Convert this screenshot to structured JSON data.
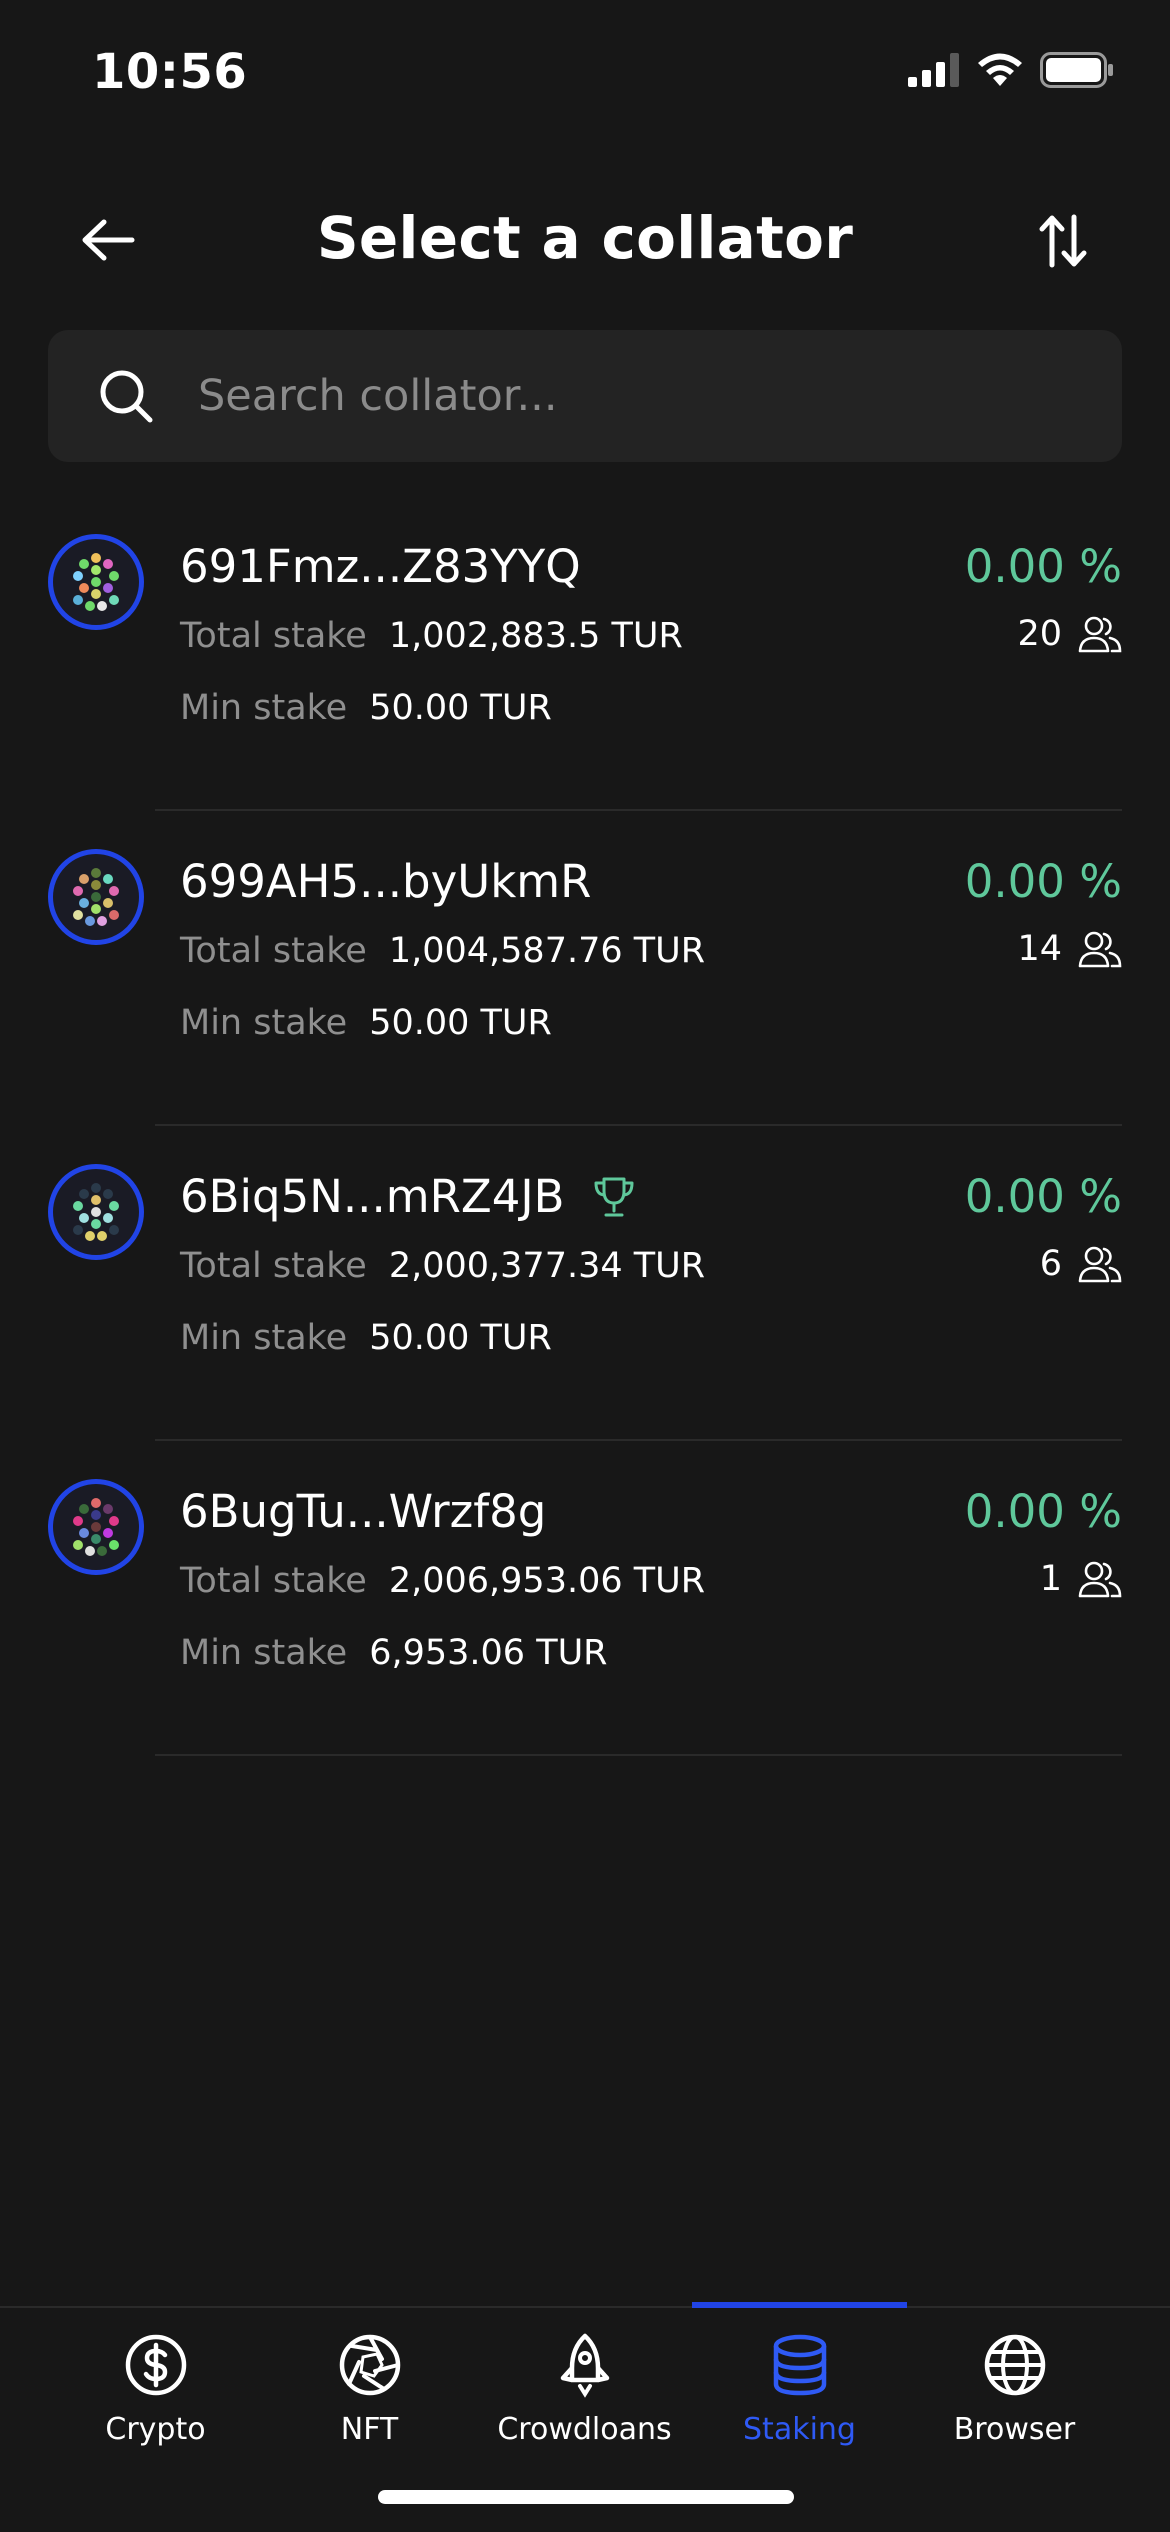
{
  "status_bar": {
    "time": "10:56"
  },
  "header": {
    "title": "Select a collator"
  },
  "search": {
    "placeholder": "Search collator..."
  },
  "collators": [
    {
      "name": "691Fmz...Z83YYQ",
      "apy": "0.00 %",
      "total_stake_label": "Total stake",
      "total_stake": "1,002,883.5 TUR",
      "min_stake_label": "Min stake",
      "min_stake": "50.00 TUR",
      "nominators": "20",
      "top": false
    },
    {
      "name": "699AH5...byUkmR",
      "apy": "0.00 %",
      "total_stake_label": "Total stake",
      "total_stake": "1,004,587.76 TUR",
      "min_stake_label": "Min stake",
      "min_stake": "50.00 TUR",
      "nominators": "14",
      "top": false
    },
    {
      "name": "6Biq5N...mRZ4JB",
      "apy": "0.00 %",
      "total_stake_label": "Total stake",
      "total_stake": "2,000,377.34 TUR",
      "min_stake_label": "Min stake",
      "min_stake": "50.00 TUR",
      "nominators": "6",
      "top": true
    },
    {
      "name": "6BugTu...Wrzf8g",
      "apy": "0.00 %",
      "total_stake_label": "Total stake",
      "total_stake": "2,006,953.06 TUR",
      "min_stake_label": "Min stake",
      "min_stake": "6,953.06 TUR",
      "nominators": "1",
      "top": false
    }
  ],
  "nav": {
    "items": [
      {
        "label": "Crypto",
        "icon": "dollar-circle-icon"
      },
      {
        "label": "NFT",
        "icon": "aperture-icon"
      },
      {
        "label": "Crowdloans",
        "icon": "rocket-icon"
      },
      {
        "label": "Staking",
        "icon": "database-icon",
        "active": true
      },
      {
        "label": "Browser",
        "icon": "globe-icon"
      }
    ]
  },
  "colors": {
    "accent": "#2144e6",
    "apy": "#5fc89b",
    "background": "#171717"
  }
}
